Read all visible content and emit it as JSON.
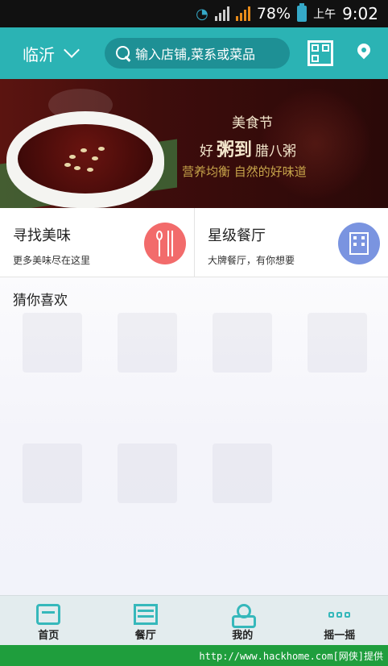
{
  "status_bar": {
    "battery": "78%",
    "ampm": "上午",
    "time": "9:02"
  },
  "header": {
    "city": "临沂",
    "search_placeholder": "输入店铺,菜系或菜品"
  },
  "banner": {
    "line1": "美食节",
    "line2_prefix": "好",
    "line2_big": "粥到",
    "line2_suffix": "腊八粥",
    "line3": "营养均衡 自然的好味道"
  },
  "features": [
    {
      "title": "寻找美味",
      "subtitle": "更多美味尽在这里",
      "icon": "cutlery-icon"
    },
    {
      "title": "星级餐厅",
      "subtitle": "大牌餐厅，有你想要",
      "icon": "building-icon"
    }
  ],
  "guess": {
    "title": "猜你喜欢"
  },
  "tabbar": {
    "tabs": [
      {
        "label": "首页",
        "icon": "home-icon"
      },
      {
        "label": "餐厅",
        "icon": "restaurant-icon"
      },
      {
        "label": "我的",
        "icon": "profile-icon"
      },
      {
        "label": "摇一摇",
        "icon": "shake-icon"
      }
    ]
  },
  "watermark": "http://www.hackhome.com[网侠]提供",
  "colors": {
    "primary": "#2bb3b4",
    "search_bg": "#1e9095",
    "red_icon": "#f26b6b",
    "blue_icon": "#7a94e0",
    "tab_accent": "#36b8bb"
  }
}
